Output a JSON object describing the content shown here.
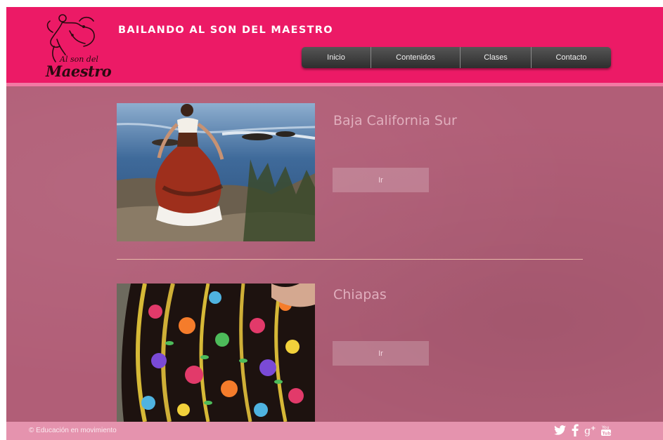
{
  "header": {
    "title": "Bailando al son del maestro",
    "logo": {
      "line1": "Al son del",
      "line2": "Maestro"
    }
  },
  "nav": {
    "items": [
      {
        "label": "Inicio"
      },
      {
        "label": "Contenidos"
      },
      {
        "label": "Clases"
      },
      {
        "label": "Contacto"
      }
    ]
  },
  "cards": [
    {
      "title": "Baja California Sur",
      "button_label": "Ir",
      "image": "dancer-coast-photo"
    },
    {
      "title": "Chiapas",
      "button_label": "Ir",
      "image": "embroidered-dress-photo"
    }
  ],
  "footer": {
    "copyright": "© Educación en movimiento",
    "social_icons": [
      "twitter-icon",
      "facebook-icon",
      "google-plus-icon",
      "youtube-icon"
    ]
  },
  "colors": {
    "header_bg": "#ec1a66",
    "nav_bg": "#3a3a3a",
    "main_bg": "#b15e77",
    "footer_bg": "#e593ae",
    "divider": "#e8b8a8"
  }
}
